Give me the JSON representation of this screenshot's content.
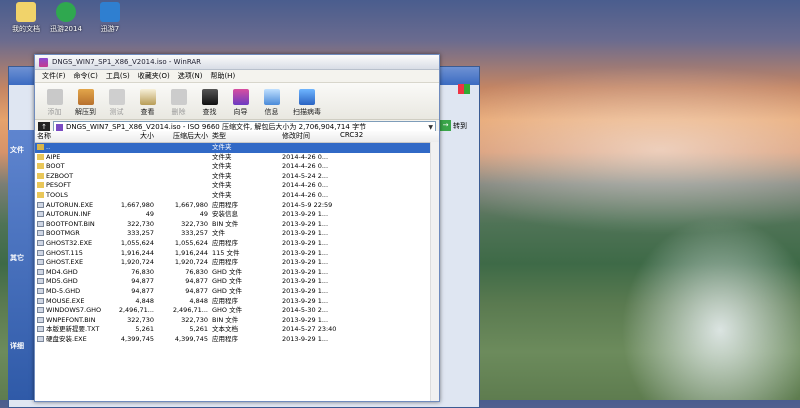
{
  "desktop": {
    "icons": [
      {
        "label": "我的文档"
      },
      {
        "label": "迅游2014"
      },
      {
        "label": "迅游7"
      }
    ],
    "side_labels": [
      "文件",
      "其它",
      "详细"
    ]
  },
  "window": {
    "title": "DNGS_WIN7_SP1_X86_V2014.iso - WinRAR",
    "menu": [
      "文件(F)",
      "命令(C)",
      "工具(S)",
      "收藏夹(O)",
      "选项(N)",
      "帮助(H)"
    ],
    "toolbar": [
      {
        "label": "添加",
        "icon": "add-icon",
        "enabled": false
      },
      {
        "label": "解压到",
        "icon": "extract-icon",
        "enabled": true
      },
      {
        "label": "测试",
        "icon": "test-icon",
        "enabled": false
      },
      {
        "label": "查看",
        "icon": "view-icon",
        "enabled": true
      },
      {
        "label": "删除",
        "icon": "delete-icon",
        "enabled": false
      },
      {
        "label": "查找",
        "icon": "find-icon",
        "enabled": true
      },
      {
        "label": "向导",
        "icon": "wizard-icon",
        "enabled": true
      },
      {
        "label": "信息",
        "icon": "info-icon",
        "enabled": true
      },
      {
        "label": "扫描病毒",
        "icon": "virus-scan-icon",
        "enabled": true
      }
    ],
    "address": "DNGS_WIN7_SP1_X86_V2014.iso - ISO 9660 压缩文件, 解包后大小为 2,706,904,714 字节",
    "goto_label": "转到",
    "columns": {
      "name": "名称",
      "size": "大小",
      "packed": "压缩后大小",
      "type": "类型",
      "modified": "修改时间",
      "crc": "CRC32"
    },
    "files": [
      {
        "name": "..",
        "size": "",
        "packed": "",
        "type": "文件夹",
        "modified": "",
        "crc": "",
        "kind": "folder",
        "selected": true
      },
      {
        "name": "AIPE",
        "size": "",
        "packed": "",
        "type": "文件夹",
        "modified": "2014-4-26 0...",
        "crc": "",
        "kind": "folder"
      },
      {
        "name": "BOOT",
        "size": "",
        "packed": "",
        "type": "文件夹",
        "modified": "2014-4-26 0...",
        "crc": "",
        "kind": "folder"
      },
      {
        "name": "EZBOOT",
        "size": "",
        "packed": "",
        "type": "文件夹",
        "modified": "2014-5-24 2...",
        "crc": "",
        "kind": "folder"
      },
      {
        "name": "PESOFT",
        "size": "",
        "packed": "",
        "type": "文件夹",
        "modified": "2014-4-26 0...",
        "crc": "",
        "kind": "folder"
      },
      {
        "name": "TOOLS",
        "size": "",
        "packed": "",
        "type": "文件夹",
        "modified": "2014-4-26 0...",
        "crc": "",
        "kind": "folder"
      },
      {
        "name": "AUTORUN.EXE",
        "size": "1,667,980",
        "packed": "1,667,980",
        "type": "应用程序",
        "modified": "2014-5-9 22:59",
        "crc": "",
        "kind": "file"
      },
      {
        "name": "AUTORUN.INF",
        "size": "49",
        "packed": "49",
        "type": "安装信息",
        "modified": "2013-9-29 1...",
        "crc": "",
        "kind": "file"
      },
      {
        "name": "BOOTFONT.BIN",
        "size": "322,730",
        "packed": "322,730",
        "type": "BIN 文件",
        "modified": "2013-9-29 1...",
        "crc": "",
        "kind": "file"
      },
      {
        "name": "BOOTMGR",
        "size": "333,257",
        "packed": "333,257",
        "type": "文件",
        "modified": "2013-9-29 1...",
        "crc": "",
        "kind": "file"
      },
      {
        "name": "GHOST32.EXE",
        "size": "1,055,624",
        "packed": "1,055,624",
        "type": "应用程序",
        "modified": "2013-9-29 1...",
        "crc": "",
        "kind": "file"
      },
      {
        "name": "GHOST.115",
        "size": "1,916,244",
        "packed": "1,916,244",
        "type": "115 文件",
        "modified": "2013-9-29 1...",
        "crc": "",
        "kind": "file"
      },
      {
        "name": "GHOST.EXE",
        "size": "1,920,724",
        "packed": "1,920,724",
        "type": "应用程序",
        "modified": "2013-9-29 1...",
        "crc": "",
        "kind": "file"
      },
      {
        "name": "MD4.GHD",
        "size": "76,830",
        "packed": "76,830",
        "type": "GHD 文件",
        "modified": "2013-9-29 1...",
        "crc": "",
        "kind": "file"
      },
      {
        "name": "MD5.GHD",
        "size": "94,877",
        "packed": "94,877",
        "type": "GHD 文件",
        "modified": "2013-9-29 1...",
        "crc": "",
        "kind": "file"
      },
      {
        "name": "MD-5.GHD",
        "size": "94,877",
        "packed": "94,877",
        "type": "GHD 文件",
        "modified": "2013-9-29 1...",
        "crc": "",
        "kind": "file"
      },
      {
        "name": "MOUSE.EXE",
        "size": "4,848",
        "packed": "4,848",
        "type": "应用程序",
        "modified": "2013-9-29 1...",
        "crc": "",
        "kind": "file"
      },
      {
        "name": "WINDOWS7.GHO",
        "size": "2,496,71...",
        "packed": "2,496,71...",
        "type": "GHO 文件",
        "modified": "2014-5-30 2...",
        "crc": "",
        "kind": "file"
      },
      {
        "name": "WNPEFONT.BIN",
        "size": "322,730",
        "packed": "322,730",
        "type": "BIN 文件",
        "modified": "2013-9-29 1...",
        "crc": "",
        "kind": "file"
      },
      {
        "name": "本版更新提要.TXT",
        "size": "5,261",
        "packed": "5,261",
        "type": "文本文档",
        "modified": "2014-5-27 23:40",
        "crc": "",
        "kind": "file"
      },
      {
        "name": "硬盘安装.EXE",
        "size": "4,399,745",
        "packed": "4,399,745",
        "type": "应用程序",
        "modified": "2013-9-29 1...",
        "crc": "",
        "kind": "file"
      }
    ]
  }
}
